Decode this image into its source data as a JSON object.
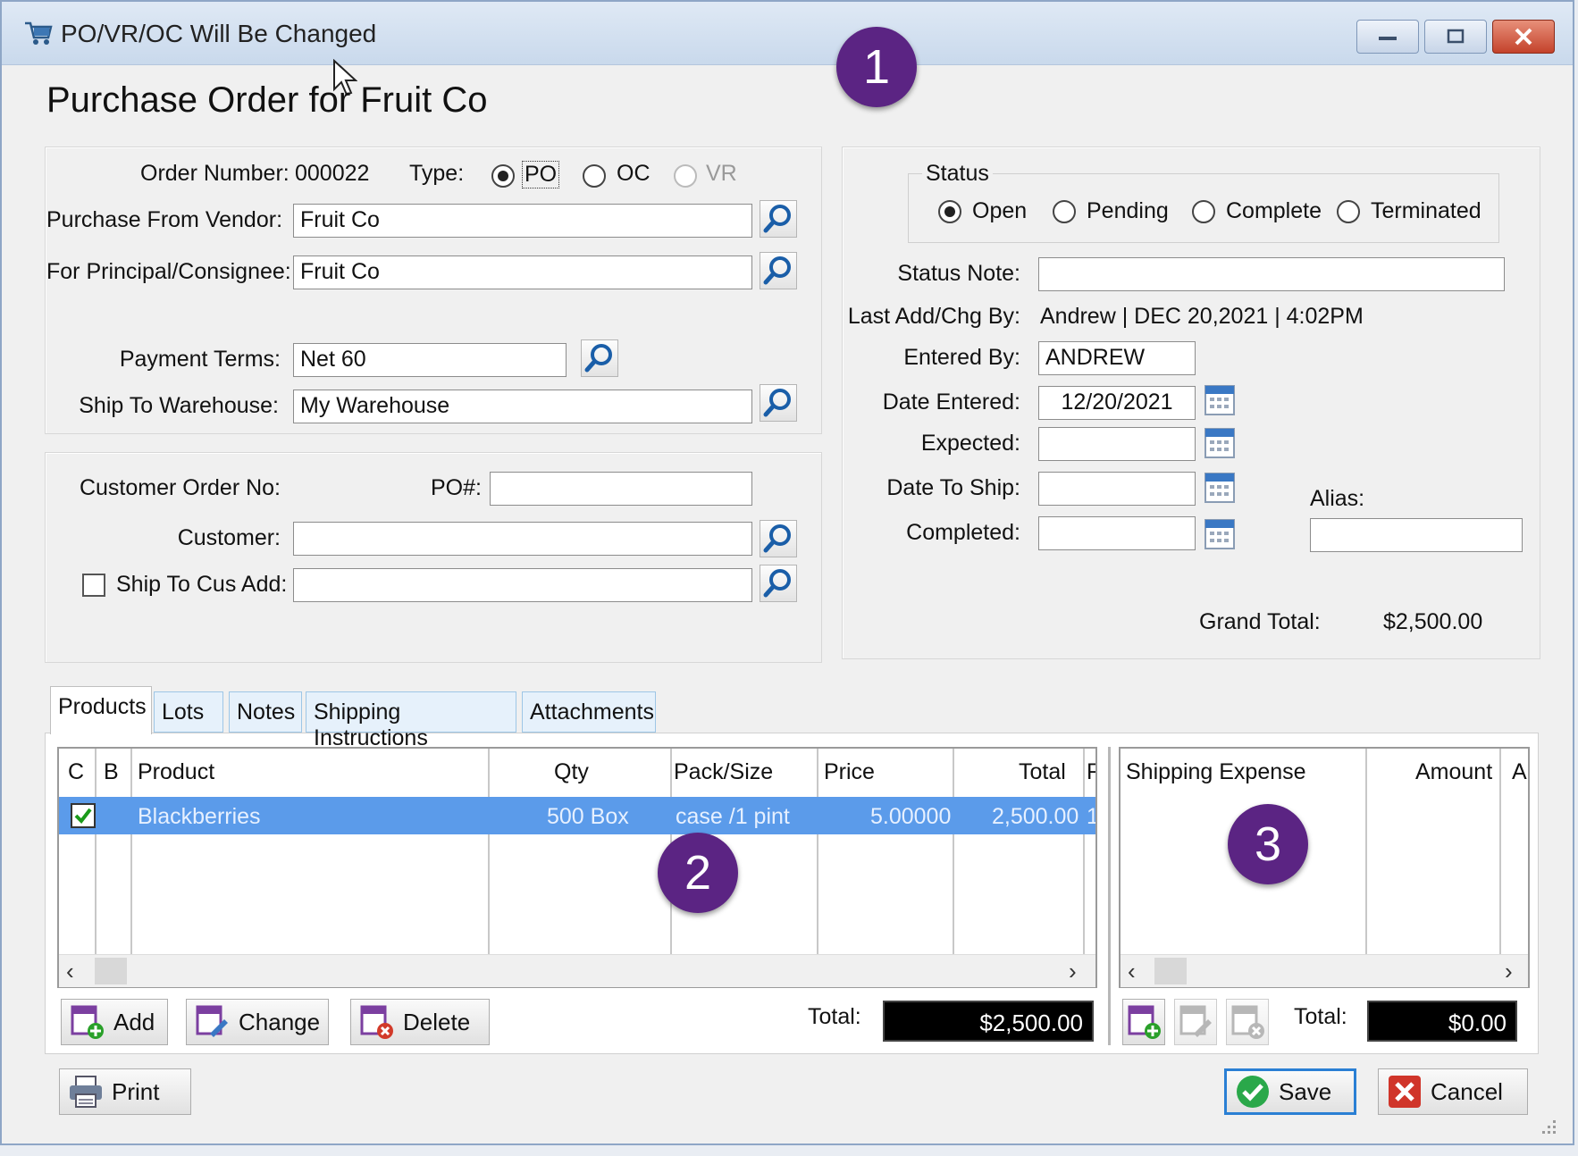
{
  "window": {
    "title": "PO/VR/OC Will Be Changed",
    "heading": "Purchase Order for Fruit Co"
  },
  "header": {
    "order_number_label": "Order Number:",
    "order_number": "000022",
    "type_label": "Type:",
    "type_options": [
      "PO",
      "OC",
      "VR"
    ],
    "vendor_label": "Purchase From Vendor:",
    "vendor": "Fruit Co",
    "principal_label": "For Principal/Consignee:",
    "principal": "Fruit Co",
    "payment_terms_label": "Payment Terms:",
    "payment_terms": "Net 60",
    "warehouse_label": "Ship To Warehouse:",
    "warehouse": "My Warehouse"
  },
  "customer": {
    "order_no_label": "Customer Order No:",
    "po_label": "PO#:",
    "po_value": "",
    "customer_label": "Customer:",
    "customer_value": "",
    "ship_to_cus_label": "Ship To Cus Add:",
    "ship_to_cus_value": ""
  },
  "status": {
    "group_label": "Status",
    "options": [
      "Open",
      "Pending",
      "Complete",
      "Terminated"
    ],
    "selected": "Open",
    "note_label": "Status Note:",
    "note": "",
    "last_chg_label": "Last Add/Chg By:",
    "last_chg": "Andrew | DEC 20,2021 |  4:02PM",
    "entered_by_label": "Entered By:",
    "entered_by": "ANDREW",
    "date_entered_label": "Date Entered:",
    "date_entered": "12/20/2021",
    "expected_label": "Expected:",
    "date_to_ship_label": "Date To Ship:",
    "completed_label": "Completed:",
    "alias_label": "Alias:",
    "grand_total_label": "Grand Total:",
    "grand_total": "$2,500.00"
  },
  "tabs": [
    "Products",
    "Lots",
    "Notes",
    "Shipping Instructions",
    "Attachments"
  ],
  "products": {
    "columns": [
      "C",
      "B",
      "Product",
      "Qty",
      "Pack/Size",
      "Price",
      "Total",
      "F"
    ],
    "rows": [
      {
        "product": "Blackberries",
        "qty": "500 Box",
        "pack": "case /1 pint",
        "price": "5.00000",
        "total": "2,500.00",
        "extra": "1"
      }
    ],
    "total_label": "Total:",
    "total": "$2,500.00",
    "add_label": "Add",
    "change_label": "Change",
    "delete_label": "Delete"
  },
  "shipping": {
    "columns": [
      "Shipping Expense",
      "Amount",
      "A"
    ],
    "total_label": "Total:",
    "total": "$0.00"
  },
  "footer": {
    "print_label": "Print",
    "save_label": "Save",
    "cancel_label": "Cancel"
  },
  "badges": [
    "1",
    "2",
    "3"
  ],
  "colors": {
    "selected_row": "#5b9bea",
    "badge": "#5b2483",
    "tab_border": "#9ec6e6"
  }
}
